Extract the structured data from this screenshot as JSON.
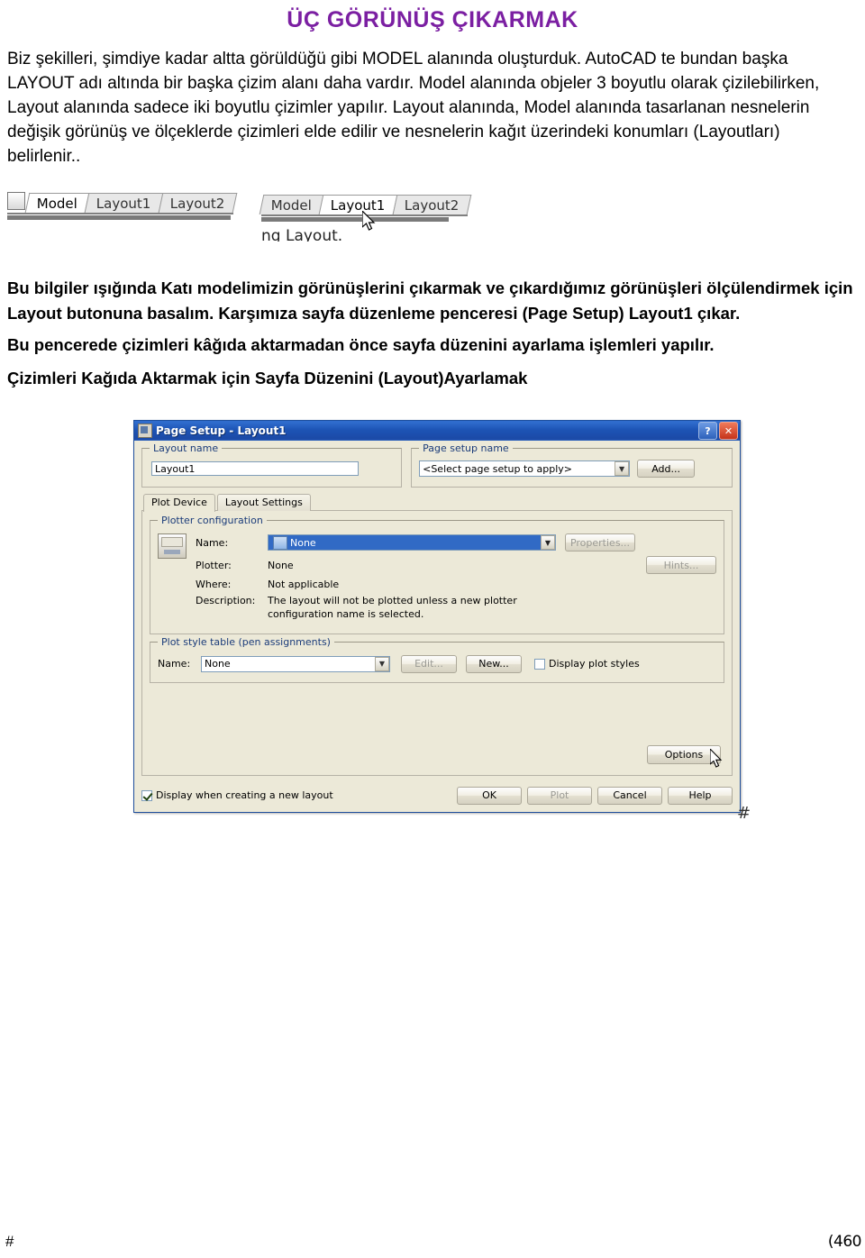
{
  "document": {
    "title": "ÜÇ GÖRÜNÜŞ ÇIKARMAK",
    "paragraph1": "Biz şekilleri, şimdiye kadar altta görüldüğü gibi MODEL alanında oluşturduk.  AutoCAD te bundan başka LAYOUT adı altında bir başka çizim alanı daha vardır. Model alanında objeler 3 boyutlu olarak çizilebilirken, Layout alanında sadece iki boyutlu çizimler yapılır. Layout alanında, Model alanında tasarlanan nesnelerin  değişik görünüş ve ölçeklerde çizimleri elde edilir ve nesnelerin kağıt üzerindeki konumları (Layoutları) belirlenir..",
    "paragraph2": "Bu bilgiler ışığında Katı modelimizin görünüşlerini çıkarmak ve çıkardığımız görünüşleri ölçülendirmek için  Layout  butonuna basalım.    Karşımıza sayfa düzenleme penceresi  (Page Setup) Layout1   çıkar.",
    "paragraph3": "Bu pencerede çizimleri kâğıda aktarmadan önce sayfa düzenini ayarlama işlemleri yapılır.",
    "heading": "Çizimleri Kağıda Aktarmak için Sayfa Düzenini (Layout)Ayarlamak",
    "footer_left": "#",
    "footer_right": "(460"
  },
  "tabstrip_left": {
    "tabs": [
      "Model",
      "Layout1",
      "Layout2"
    ]
  },
  "tabstrip_right": {
    "tabs": [
      "Model",
      "Layout1",
      "Layout2"
    ],
    "partial_text": "ng  Layout."
  },
  "dialog": {
    "title": "Page Setup - Layout1",
    "title_icon": "page-setup-icon",
    "help_button": "?",
    "close_button": "✕",
    "layout_name": {
      "legend": "Layout name",
      "value": "Layout1"
    },
    "page_setup_name": {
      "legend": "Page setup name",
      "value": "<Select page setup to apply>",
      "add_button": "Add..."
    },
    "tabs": [
      {
        "label": "Plot Device",
        "active": true
      },
      {
        "label": "Layout Settings",
        "active": false
      }
    ],
    "plotter_configuration": {
      "legend": "Plotter configuration",
      "name_label": "Name:",
      "name_value": "None",
      "properties_button": "Properties...",
      "hints_button": "Hints...",
      "plotter_label": "Plotter:",
      "plotter_value": "None",
      "where_label": "Where:",
      "where_value": "Not applicable",
      "description_label": "Description:",
      "description_value": "The layout will not be plotted unless a new plotter configuration name is selected."
    },
    "plot_style_table": {
      "legend": "Plot style table (pen assignments)",
      "name_label": "Name:",
      "name_value": "None",
      "edit_button": "Edit...",
      "new_button": "New...",
      "display_checkbox_label": "Display plot styles",
      "display_checkbox_checked": false
    },
    "options_button": "Options",
    "display_when_creating": {
      "label": "Display when creating a new layout",
      "checked": true
    },
    "footer_buttons": [
      {
        "label": "OK",
        "disabled": false
      },
      {
        "label": "Plot",
        "disabled": true
      },
      {
        "label": "Cancel",
        "disabled": false
      },
      {
        "label": "Help",
        "disabled": false
      }
    ],
    "hash_mark": "#"
  },
  "colors": {
    "title": "#7b1fa2",
    "titlebar_start": "#2f6ccd",
    "titlebar_end": "#1b49a6",
    "dialog_face": "#ece9d8",
    "selection": "#316ac5"
  }
}
